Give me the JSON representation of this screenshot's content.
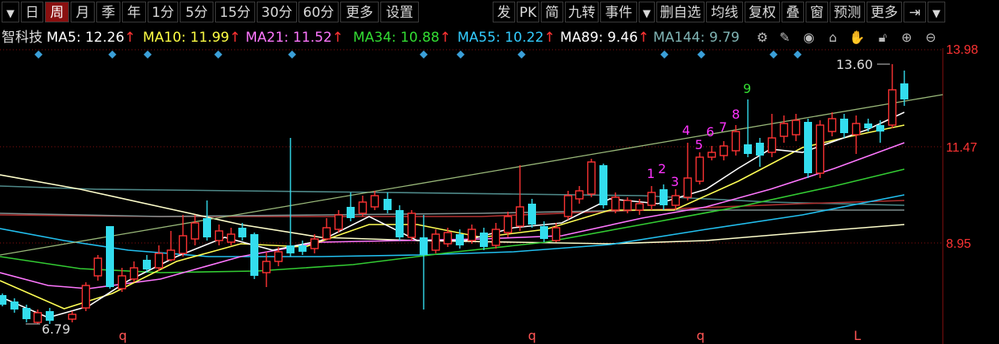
{
  "toolbar": {
    "left": [
      "日",
      "周",
      "月",
      "季",
      "年",
      "1分",
      "5分",
      "15分",
      "30分",
      "60分",
      "更多",
      "设置"
    ],
    "active": "周",
    "right": [
      "发",
      "PK",
      "简",
      "九转",
      "事件",
      "删自选",
      "均线",
      "复权",
      "叠",
      "窗",
      "预测",
      "更多"
    ]
  },
  "legend": {
    "stock_name": "智科技",
    "ma": [
      {
        "label": "MA5:",
        "value": "12.26",
        "color": "#ffffff",
        "arrow": "↑"
      },
      {
        "label": "MA10:",
        "value": "11.99",
        "color": "#ffff44",
        "arrow": "↑"
      },
      {
        "label": "MA21:",
        "value": "11.52",
        "color": "#ff77ff",
        "arrow": "↑"
      },
      {
        "label": "MA34:",
        "value": "10.88",
        "color": "#33dd33",
        "arrow": "↑"
      },
      {
        "label": "MA55:",
        "value": "10.22",
        "color": "#33ccff",
        "arrow": "↑"
      },
      {
        "label": "MA89:",
        "value": "9.46",
        "color": "#ffffff",
        "arrow": "↑"
      },
      {
        "label": "MA144:",
        "value": "9.79",
        "color": "#7fb3b3",
        "arrow": ""
      }
    ]
  },
  "price_axis": {
    "labels": [
      "13.98",
      "11.47",
      "8.95"
    ],
    "color": "#ff3333"
  },
  "annotations": {
    "high": "13.60",
    "low": "6.79",
    "nine_turn": [
      "1",
      "2",
      "3",
      "4",
      "5",
      "6",
      "7",
      "8",
      "9"
    ],
    "bottom_markers": [
      "q",
      "q",
      "q",
      "L"
    ]
  },
  "colors": {
    "up": "#ff3333",
    "down": "#33ddee",
    "trend": "#9ab97a",
    "background": "#000000"
  }
}
